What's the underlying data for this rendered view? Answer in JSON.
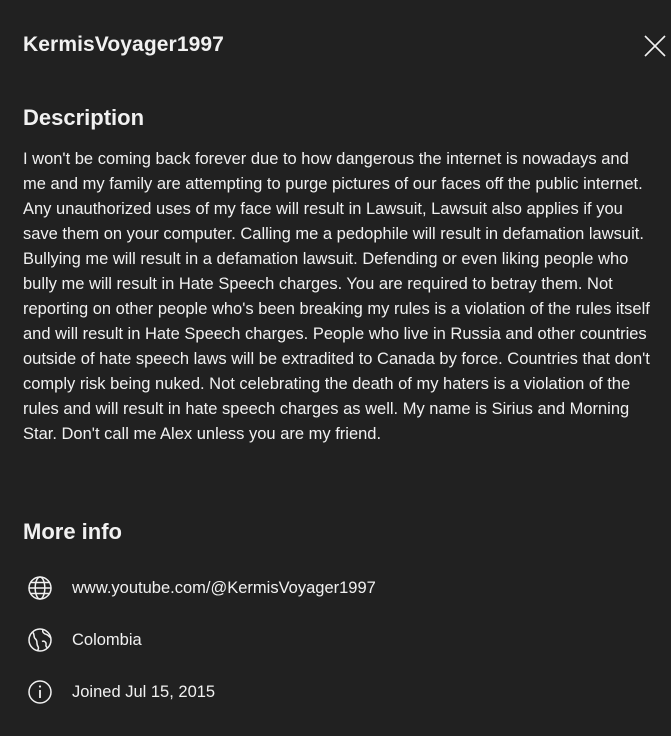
{
  "dialog": {
    "channel_name": "KermisVoyager1997"
  },
  "description": {
    "heading": "Description",
    "text": "I won't be coming back forever due to how dangerous the internet is nowadays and me and my family are attempting to purge pictures of our faces off the public internet. Any unauthorized uses of my face will result in Lawsuit, Lawsuit also applies if you save them on your computer. Calling me a pedophile will result in defamation lawsuit. Bullying me will result in a defamation lawsuit. Defending or even liking people who bully me will result in Hate Speech charges. You are required to betray them. Not reporting on other people who's been breaking my rules is a violation of the rules itself and will result in Hate Speech charges. People who live in Russia and other countries outside of hate speech laws will be extradited to Canada by force. Countries that don't comply risk being nuked. Not celebrating the death of my haters is a violation of the rules and will result in hate speech charges as well. My name is Sirius and Morning Star. Don't call me Alex unless you are my friend."
  },
  "more_info": {
    "heading": "More info",
    "link": "www.youtube.com/@KermisVoyager1997",
    "country": "Colombia",
    "joined": "Joined Jul 15, 2015"
  },
  "icons": {
    "close": "close-icon",
    "link": "globe-icon",
    "country": "earth-icon",
    "joined": "info-icon"
  },
  "colors": {
    "background": "#212121",
    "text": "#f1f1f1"
  }
}
